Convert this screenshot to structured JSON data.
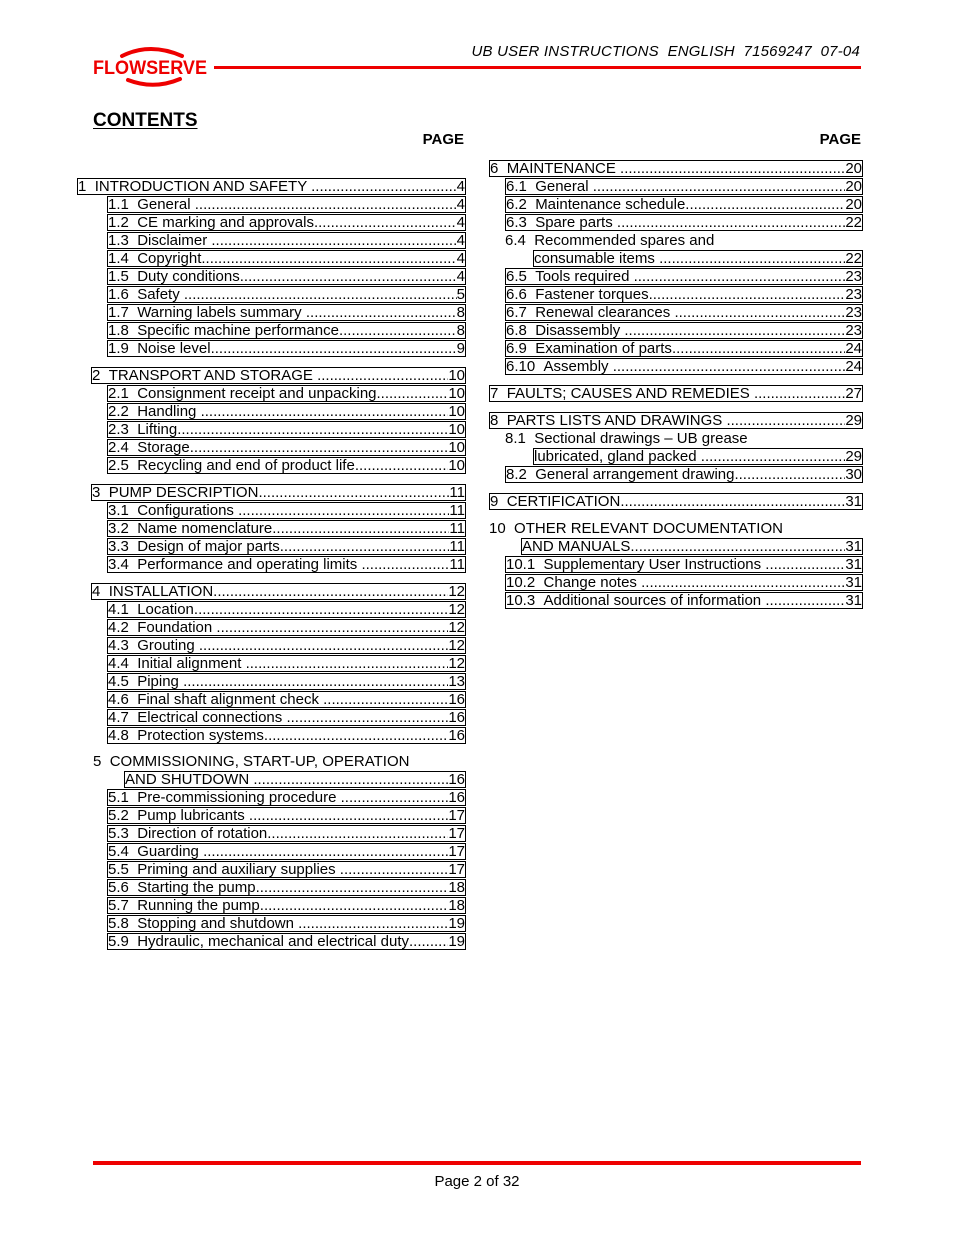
{
  "header": {
    "logo_text": "FLOWSERVE",
    "title": "UB USER INSTRUCTIONS  ENGLISH  71569247  07-04",
    "brand_color": "#ee0000"
  },
  "contents": {
    "title": "CONTENTS",
    "page_heading": "PAGE"
  },
  "left_column": [
    {
      "id": "s1",
      "num": "1  ",
      "label": "INTRODUCTION AND SAFETY ",
      "page": "4"
    },
    {
      "id": "s1-1",
      "num": "1.1  ",
      "label": "General ",
      "page": "4"
    },
    {
      "id": "s1-2",
      "num": "1.2  ",
      "label": "CE marking and approvals",
      "page": "4"
    },
    {
      "id": "s1-3",
      "num": "1.3  ",
      "label": "Disclaimer ",
      "page": "4"
    },
    {
      "id": "s1-4",
      "num": "1.4  ",
      "label": "Copyright",
      "page": "4"
    },
    {
      "id": "s1-5",
      "num": "1.5  ",
      "label": "Duty conditions",
      "page": "4"
    },
    {
      "id": "s1-6",
      "num": "1.6  ",
      "label": "Safety ",
      "page": "5"
    },
    {
      "id": "s1-7",
      "num": "1.7  ",
      "label": "Warning labels summary ",
      "page": "8"
    },
    {
      "id": "s1-8",
      "num": "1.8  ",
      "label": "Specific machine performance",
      "page": "8"
    },
    {
      "id": "s1-9",
      "num": "1.9  ",
      "label": "Noise level",
      "page": "9"
    },
    {
      "id": "s2",
      "num": "2  ",
      "label": "TRANSPORT AND STORAGE ",
      "page": "10"
    },
    {
      "id": "s2-1",
      "num": "2.1  ",
      "label": "Consignment receipt and unpacking",
      "page": "10"
    },
    {
      "id": "s2-2",
      "num": "2.2  ",
      "label": "Handling ",
      "page": "10"
    },
    {
      "id": "s2-3",
      "num": "2.3  ",
      "label": "Lifting",
      "page": "10"
    },
    {
      "id": "s2-4",
      "num": "2.4  ",
      "label": "Storage",
      "page": "10"
    },
    {
      "id": "s2-5",
      "num": "2.5  ",
      "label": "Recycling and end of product life",
      "page": "10"
    },
    {
      "id": "s3",
      "num": "3  ",
      "label": "PUMP DESCRIPTION",
      "page": "11"
    },
    {
      "id": "s3-1",
      "num": "3.1  ",
      "label": "Configurations ",
      "page": "11"
    },
    {
      "id": "s3-2",
      "num": "3.2  ",
      "label": "Name nomenclature",
      "page": "11"
    },
    {
      "id": "s3-3",
      "num": "3.3  ",
      "label": "Design of major parts",
      "page": "11"
    },
    {
      "id": "s3-4",
      "num": "3.4  ",
      "label": "Performance and operating limits ",
      "page": "11"
    },
    {
      "id": "s4",
      "num": "4  ",
      "label": "INSTALLATION",
      "page": "12"
    },
    {
      "id": "s4-1",
      "num": "4.1  ",
      "label": "Location",
      "page": "12"
    },
    {
      "id": "s4-2",
      "num": "4.2  ",
      "label": "Foundation ",
      "page": "12"
    },
    {
      "id": "s4-3",
      "num": "4.3  ",
      "label": "Grouting ",
      "page": "12"
    },
    {
      "id": "s4-4",
      "num": "4.4  ",
      "label": "Initial alignment ",
      "page": "12"
    },
    {
      "id": "s4-5",
      "num": "4.5  ",
      "label": "Piping ",
      "page": "13"
    },
    {
      "id": "s4-6",
      "num": "4.6  ",
      "label": "Final shaft alignment check ",
      "page": "16"
    },
    {
      "id": "s4-7",
      "num": "4.7  ",
      "label": "Electrical connections ",
      "page": "16"
    },
    {
      "id": "s4-8",
      "num": "4.8  ",
      "label": "Protection systems",
      "page": "16"
    },
    {
      "id": "s5",
      "num": "5  ",
      "label_line1": "COMMISSIONING, START-UP, OPERATION",
      "label": "AND SHUTDOWN ",
      "page": "16"
    },
    {
      "id": "s5-1",
      "num": "5.1  ",
      "label": "Pre-commissioning procedure ",
      "page": "16"
    },
    {
      "id": "s5-2",
      "num": "5.2  ",
      "label": "Pump lubricants ",
      "page": "17"
    },
    {
      "id": "s5-3",
      "num": "5.3  ",
      "label": "Direction of rotation",
      "page": "17"
    },
    {
      "id": "s5-4",
      "num": "5.4  ",
      "label": "Guarding ",
      "page": "17"
    },
    {
      "id": "s5-5",
      "num": "5.5  ",
      "label": "Priming and auxiliary supplies ",
      "page": "17"
    },
    {
      "id": "s5-6",
      "num": "5.6  ",
      "label": "Starting the pump",
      "page": "18"
    },
    {
      "id": "s5-7",
      "num": "5.7  ",
      "label": "Running the pump",
      "page": "18"
    },
    {
      "id": "s5-8",
      "num": "5.8  ",
      "label": "Stopping and shutdown ",
      "page": "19"
    },
    {
      "id": "s5-9",
      "num": "5.9  ",
      "label": "Hydraulic, mechanical and electrical duty",
      "page": "19"
    }
  ],
  "right_column": [
    {
      "id": "s6",
      "num": "6  ",
      "label": "MAINTENANCE ",
      "page": "20"
    },
    {
      "id": "s6-1",
      "num": "6.1  ",
      "label": "General ",
      "page": "20"
    },
    {
      "id": "s6-2",
      "num": "6.2  ",
      "label": "Maintenance schedule",
      "page": "20"
    },
    {
      "id": "s6-3",
      "num": "6.3  ",
      "label": "Spare parts ",
      "page": "22"
    },
    {
      "id": "s6-4",
      "num": "6.4  ",
      "label_line1": "Recommended spares and",
      "label": "consumable items ",
      "page": "22"
    },
    {
      "id": "s6-5",
      "num": "6.5  ",
      "label": "Tools required ",
      "page": "23"
    },
    {
      "id": "s6-6",
      "num": "6.6  ",
      "label": "Fastener torques",
      "page": "23"
    },
    {
      "id": "s6-7",
      "num": "6.7  ",
      "label": "Renewal clearances ",
      "page": "23"
    },
    {
      "id": "s6-8",
      "num": "6.8  ",
      "label": "Disassembly ",
      "page": "23"
    },
    {
      "id": "s6-9",
      "num": "6.9  ",
      "label": "Examination of parts",
      "page": "24"
    },
    {
      "id": "s6-10",
      "num": "6.10  ",
      "label": "Assembly ",
      "page": "24"
    },
    {
      "id": "s7",
      "num": "7  ",
      "label": "FAULTS; CAUSES AND REMEDIES ",
      "page": "27"
    },
    {
      "id": "s8",
      "num": "8  ",
      "label": "PARTS LISTS AND DRAWINGS ",
      "page": "29"
    },
    {
      "id": "s8-1",
      "num": "8.1  ",
      "label_line1": "Sectional drawings – UB grease",
      "label": "lubricated, gland packed ",
      "page": "29"
    },
    {
      "id": "s8-2",
      "num": "8.2  ",
      "label": "General arrangement drawing",
      "page": "30"
    },
    {
      "id": "s9",
      "num": "9  ",
      "label": "CERTIFICATION",
      "page": "31"
    },
    {
      "id": "s10",
      "num": "10  ",
      "label_line1": "OTHER RELEVANT DOCUMENTATION",
      "label": "AND MANUALS",
      "page": "31"
    },
    {
      "id": "s10-1",
      "num": "10.1  ",
      "label": "Supplementary User Instructions ",
      "page": "31"
    },
    {
      "id": "s10-2",
      "num": "10.2  ",
      "label": "Change notes ",
      "page": "31"
    },
    {
      "id": "s10-3",
      "num": "10.3  ",
      "label": "Additional sources of information ",
      "page": "31"
    }
  ],
  "footer": {
    "page_text": "Page 2 of 32"
  }
}
